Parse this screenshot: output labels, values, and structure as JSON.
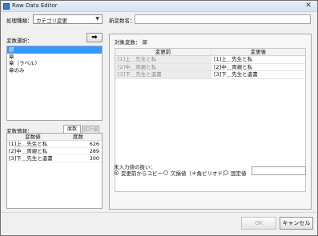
{
  "window": {
    "title": "Raw Data Editor",
    "close_glyph": "✕"
  },
  "process_type": {
    "label": "処理種類：",
    "value": "カテゴリ変更"
  },
  "new_var": {
    "label": "新変数名：",
    "value": ""
  },
  "var_select": {
    "label": "変数選択：",
    "move_glyph": "➡",
    "items": [
      "郎",
      "章",
      "章（ラベル）",
      "章のみ"
    ],
    "selected_index": 0
  },
  "var_info": {
    "label": "変数情報：",
    "tabs": [
      "度数",
      "統計値"
    ],
    "headers": [
      "変数値",
      "度数"
    ],
    "rows": [
      {
        "value": "[1]上＿先生と私",
        "count": "626"
      },
      {
        "value": "[2]中＿両親と私",
        "count": "289"
      },
      {
        "value": "[3]下＿先生と遺書",
        "count": "300"
      }
    ]
  },
  "target": {
    "label": "対象変数：",
    "value": "郎"
  },
  "mapping": {
    "headers": [
      "変更前",
      "変更後"
    ],
    "rows": [
      {
        "before": "[1]上＿先生と私",
        "after": "[1]上＿先生と私"
      },
      {
        "before": "[2]中＿両親と私",
        "after": "[2]中＿両親と私"
      },
      {
        "before": "[3]下＿先生と遺書",
        "after": "[3]下＿先生と遺書"
      }
    ]
  },
  "missing": {
    "label": "未入力値の扱い：",
    "options": [
      "変更前からコピー",
      "欠損値（＊角ピリオド）",
      "固定値"
    ],
    "selected_index": 0,
    "fixed_value": ""
  },
  "buttons": {
    "ok": "OK",
    "cancel": "キャンセル"
  },
  "colors": {
    "selection": "#3399ff",
    "title_icon": "#3c78c8"
  }
}
